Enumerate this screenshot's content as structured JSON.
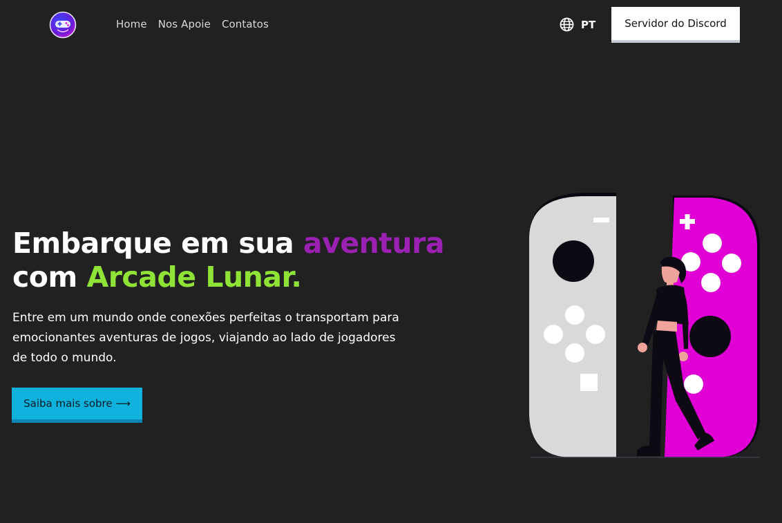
{
  "header": {
    "nav": [
      "Home",
      "Nos Apoie",
      "Contatos"
    ],
    "lang_code": "PT",
    "discord_label": "Servidor do Discord"
  },
  "hero": {
    "title_part1": "Embarque em sua ",
    "title_highlight1": "aventura",
    "title_part2": "com ",
    "title_highlight2": "Arcade Lunar.",
    "description": "Entre em um mundo onde conexões perfeitas o transportam para emocionantes aventuras de jogos, viajando ao lado de jogadores de todo o mundo.",
    "cta_label": "Saiba mais sobre ⟶"
  },
  "colors": {
    "background": "#212121",
    "accent_purple": "#9b21b3",
    "accent_green": "#8fe337",
    "cta_blue": "#0fb2dc",
    "joycon_left": "#d9d9d9",
    "joycon_right": "#e000d6"
  },
  "icons": {
    "logo": "controller-moon-logo",
    "language": "globe-icon"
  }
}
